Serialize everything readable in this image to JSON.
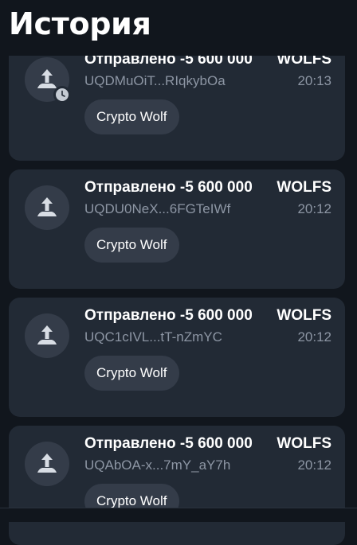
{
  "header": {
    "title": "История"
  },
  "transactions": [
    {
      "title_amount": "Отправлено -5 600 000",
      "title_token": "WOLFS",
      "address": "UQDMuOiT...RIqkybOa",
      "time": "20:13",
      "tag": "Crypto Wolf",
      "icon": "upload-arrow-icon",
      "status_icon": "clock-icon",
      "pending": true
    },
    {
      "title_amount": "Отправлено -5 600 000",
      "title_token": "WOLFS",
      "address": "UQDU0NeX...6FGTeIWf",
      "time": "20:12",
      "tag": "Crypto Wolf",
      "icon": "upload-arrow-icon",
      "pending": false
    },
    {
      "title_amount": "Отправлено -5 600 000",
      "title_token": "WOLFS",
      "address": "UQC1cIVL...tT-nZmYC",
      "time": "20:12",
      "tag": "Crypto Wolf",
      "icon": "upload-arrow-icon",
      "pending": false
    },
    {
      "title_amount": "Отправлено -5 600 000",
      "title_token": "WOLFS",
      "address": "UQAbOA-x...7mY_aY7h",
      "time": "20:12",
      "tag": "Crypto Wolf",
      "icon": "upload-arrow-icon",
      "pending": false
    }
  ],
  "colors": {
    "background": "#11161d",
    "card": "#222a35",
    "chip": "#343c49",
    "secondary_text": "#8d96a4",
    "primary_text": "#ffffff"
  }
}
